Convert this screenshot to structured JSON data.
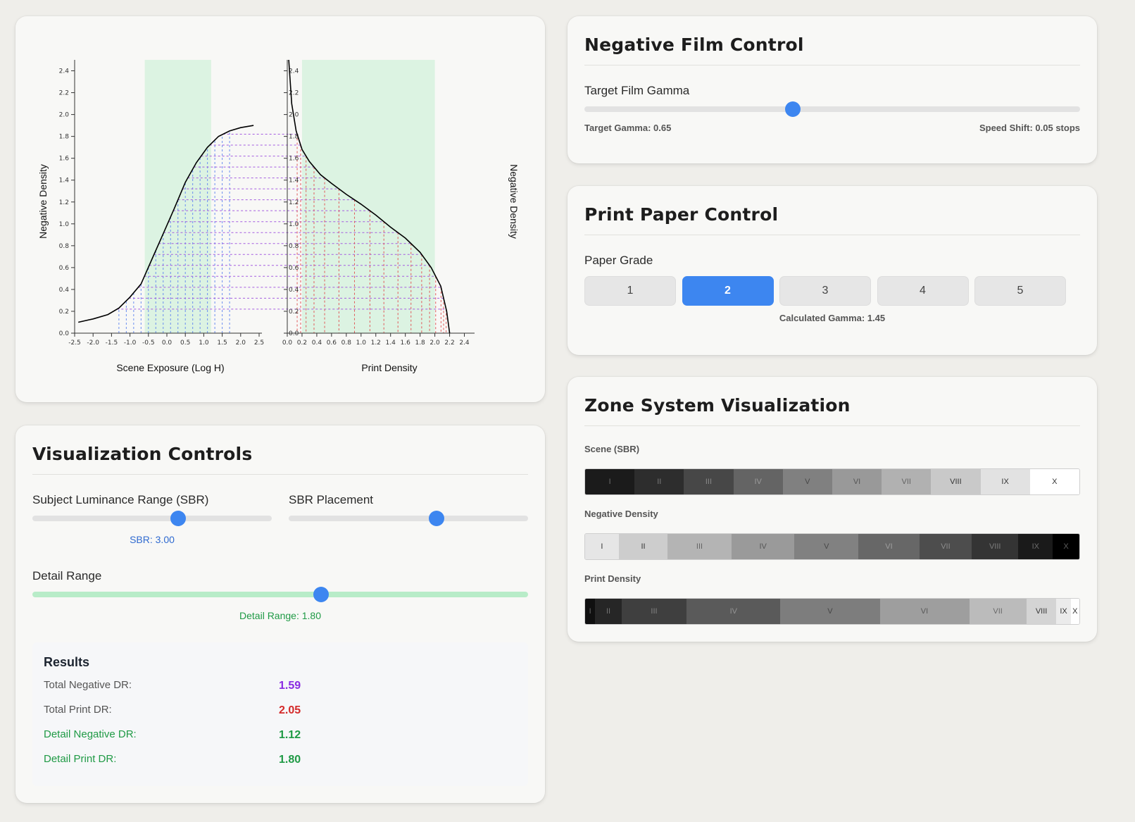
{
  "chart": {
    "left_xlabel": "Scene Exposure (Log H)",
    "left_ylabel": "Negative Density",
    "right_xlabel": "Print Density",
    "right_ylabel": "Negative Density",
    "left_xticks": [
      "-2.5",
      "-2.0",
      "-1.5",
      "-1.0",
      "-0.5",
      "0.0",
      "0.5",
      "1.0",
      "1.5",
      "2.0",
      "2.5"
    ],
    "right_xticks": [
      "0.0",
      "0.2",
      "0.4",
      "0.6",
      "0.8",
      "1.0",
      "1.2",
      "1.4",
      "1.6",
      "1.8",
      "2.0",
      "2.2",
      "2.4"
    ],
    "yticks": [
      "0.0",
      "0.2",
      "0.4",
      "0.6",
      "0.8",
      "1.0",
      "1.2",
      "1.4",
      "1.6",
      "1.8",
      "2.0",
      "2.2",
      "2.4"
    ]
  },
  "chart_data": [
    {
      "type": "line",
      "xlabel": "Scene Exposure (Log H)",
      "ylabel": "Negative Density",
      "xlim": [
        -2.5,
        2.5
      ],
      "ylim": [
        0,
        2.5
      ],
      "highlight_range_x": [
        -0.6,
        1.2
      ],
      "curve": {
        "x": [
          -2.4,
          -2.0,
          -1.6,
          -1.3,
          -1.0,
          -0.7,
          -0.4,
          -0.1,
          0.2,
          0.5,
          0.8,
          1.1,
          1.4,
          1.7,
          2.0,
          2.35
        ],
        "y": [
          0.1,
          0.13,
          0.17,
          0.23,
          0.33,
          0.45,
          0.68,
          0.91,
          1.14,
          1.38,
          1.56,
          1.7,
          1.8,
          1.85,
          1.88,
          1.9
        ]
      }
    },
    {
      "type": "line",
      "xlabel": "Print Density",
      "ylabel": "Negative Density",
      "xlim": [
        0,
        2.5
      ],
      "ylim": [
        0,
        2.5
      ],
      "highlight_range_x": [
        0.2,
        2.0
      ],
      "curve": {
        "x": [
          0.02,
          0.06,
          0.12,
          0.2,
          0.3,
          0.45,
          0.6,
          0.8,
          1.0,
          1.2,
          1.4,
          1.6,
          1.8,
          1.95,
          2.08,
          2.16,
          2.2
        ],
        "y": [
          2.5,
          2.1,
          1.85,
          1.68,
          1.57,
          1.45,
          1.37,
          1.27,
          1.18,
          1.08,
          0.97,
          0.87,
          0.74,
          0.6,
          0.43,
          0.2,
          0.0
        ]
      }
    }
  ],
  "viz": {
    "title": "Visualization Controls",
    "sbr_label": "Subject Luminance Range (SBR)",
    "sbr_value_text": "SBR: 3.00",
    "sbr_fraction": 0.608,
    "placement_label": "SBR Placement",
    "placement_fraction": 0.618,
    "detail_label": "Detail Range",
    "detail_value_text": "Detail Range: 1.80",
    "detail_fraction": 0.583,
    "results_title": "Results",
    "results": [
      {
        "label": "Total Negative DR:",
        "value": "1.59",
        "color": "#8a2be2",
        "label_color": "#555"
      },
      {
        "label": "Total Print DR:",
        "value": "2.05",
        "color": "#d42a2a",
        "label_color": "#555"
      },
      {
        "label": "Detail Negative DR:",
        "value": "1.12",
        "color": "#1f9a45",
        "label_color": "#1f9a45"
      },
      {
        "label": "Detail Print DR:",
        "value": "1.80",
        "color": "#1f9a45",
        "label_color": "#1f9a45"
      }
    ]
  },
  "negative": {
    "title": "Negative Film Control",
    "label": "Target Film Gamma",
    "gamma_fraction": 0.42,
    "target_text": "Target Gamma: 0.65",
    "shift_text": "Speed Shift: 0.05 stops"
  },
  "paper": {
    "title": "Print Paper Control",
    "label": "Paper Grade",
    "grades": [
      "1",
      "2",
      "3",
      "4",
      "5"
    ],
    "active_grade": "2",
    "gamma_text": "Calculated Gamma: 1.45"
  },
  "zones": {
    "title": "Zone System Visualization",
    "scene_label": "Scene (SBR)",
    "negative_label": "Negative Density",
    "print_label": "Print Density",
    "numerals": [
      "I",
      "II",
      "III",
      "IV",
      "V",
      "VI",
      "VII",
      "VIII",
      "IX",
      "X"
    ],
    "scene_colors": [
      "#1b1b1b",
      "#2d2d2d",
      "#474747",
      "#646464",
      "#808080",
      "#999999",
      "#b1b1b1",
      "#c9c9c9",
      "#e2e2e2",
      "#ffffff"
    ],
    "negative_colors": [
      "#e6e6e6",
      "#cdcdcd",
      "#b4b4b4",
      "#9a9a9a",
      "#818181",
      "#676767",
      "#4d4d4d",
      "#343434",
      "#1a1a1a",
      "#000000"
    ],
    "negative_widths": [
      47,
      68,
      89,
      88,
      89,
      85,
      73,
      65,
      48,
      37
    ],
    "print_colors": [
      "#101010",
      "#262626",
      "#3f3f3f",
      "#5a5a5a",
      "#7d7d7d",
      "#9e9e9e",
      "#bbbbbb",
      "#d4d4d4",
      "#ebebeb",
      "#ffffff"
    ],
    "print_widths": [
      14,
      37,
      91,
      131,
      139,
      125,
      80,
      42,
      20,
      12
    ]
  }
}
